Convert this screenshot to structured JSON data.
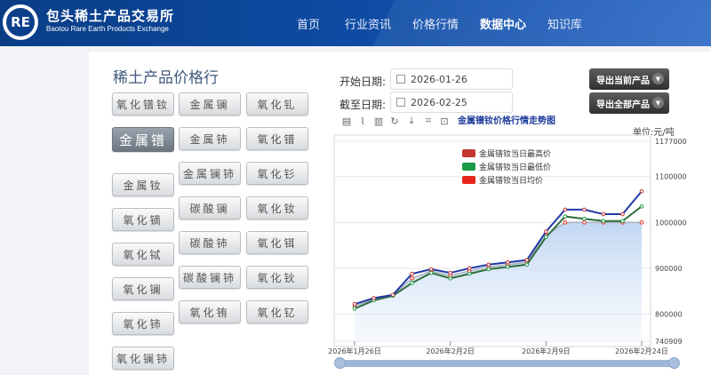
{
  "header": {
    "logo_mark": "RE",
    "logo_cn": "包头稀土产品交易所",
    "logo_en": "Baotou Rare Earth Products Exchange",
    "nav": [
      {
        "label": "首页",
        "active": false
      },
      {
        "label": "行业资讯",
        "active": false
      },
      {
        "label": "价格行情",
        "active": false
      },
      {
        "label": "数据中心",
        "active": true
      },
      {
        "label": "知识库",
        "active": false
      }
    ]
  },
  "page_title": "稀土产品价格行",
  "products": [
    {
      "label": "氧化镨钕",
      "active": false
    },
    {
      "label": "金属镧",
      "active": false
    },
    {
      "label": "氧化钆",
      "active": false
    },
    {
      "label": "金属镨",
      "active": true
    },
    {
      "label": "金属铈",
      "active": false
    },
    {
      "label": "氧化镨",
      "active": false
    },
    {
      "label": "金属镧铈",
      "active": false
    },
    {
      "label": "氧化钐",
      "active": false
    },
    {
      "label": "金属钕",
      "active": false
    },
    {
      "label": "碳酸镧",
      "active": false
    },
    {
      "label": "氧化钕",
      "active": false
    },
    {
      "label": "氧化镝",
      "active": false
    },
    {
      "label": "碳酸铈",
      "active": false
    },
    {
      "label": "氧化铒",
      "active": false
    },
    {
      "label": "氧化铽",
      "active": false
    },
    {
      "label": "碳酸镧铈",
      "active": false
    },
    {
      "label": "氧化钬",
      "active": false
    },
    {
      "label": "氧化镧",
      "active": false
    },
    {
      "label": "氧化铕",
      "active": false
    },
    {
      "label": "氧化钇",
      "active": false
    },
    {
      "label": "氧化铈",
      "active": false
    },
    {
      "label": "氧化镧铈",
      "active": false
    }
  ],
  "filters": {
    "start_label": "开始日期:",
    "start_value": "2026-01-26",
    "end_label": "截至日期:",
    "end_value": "2026-02-25"
  },
  "exports": {
    "current": "导出当前产品",
    "all": "导出全部产品",
    "chevron_icon": "chevron-down-icon"
  },
  "toolbar_icons": [
    "document-icon",
    "line-chart-icon",
    "bar-chart-icon",
    "refresh-icon",
    "download-icon",
    "crop-icon",
    "restore-icon"
  ],
  "chart_data": {
    "type": "line",
    "title": "金属镨钕价格行情走势图",
    "unit": "单位:元/吨",
    "x": [
      "2026-01-26",
      "2026-01-27",
      "2026-01-28",
      "2026-01-29",
      "2026-01-30",
      "2026-02-02",
      "2026-02-03",
      "2026-02-04",
      "2026-02-05",
      "2026-02-06",
      "2026-02-09",
      "2026-02-10",
      "2026-02-11",
      "2026-02-12",
      "2026-02-13",
      "2026-02-24"
    ],
    "x_tick_labels": [
      "2026年1月26日",
      "2026年2月2日",
      "2026年2月9日",
      "2026年2月24日"
    ],
    "x_tick_indices": [
      0,
      5,
      10,
      15
    ],
    "ylim": [
      740909,
      1177000
    ],
    "y_tick_labels": [
      "1177000",
      "1100000",
      "1000000",
      "900000",
      "800000",
      "740909"
    ],
    "y_tick_values": [
      1177000,
      1100000,
      1000000,
      900000,
      800000,
      740909
    ],
    "grid": true,
    "legend_position": "top",
    "series": [
      {
        "name": "金属镨钕当日最高价",
        "color": "#c23531",
        "line_color": "#2038a8",
        "values": [
          822000,
          835000,
          842000,
          888000,
          898000,
          890000,
          900000,
          908000,
          913000,
          918000,
          980000,
          1028000,
          1028000,
          1018000,
          1018000,
          1068000
        ]
      },
      {
        "name": "金属镨钕当日最低价",
        "color": "#1a9b48",
        "line_color": "#2e6e3c",
        "values": [
          812000,
          830000,
          840000,
          868000,
          890000,
          878000,
          888000,
          898000,
          903000,
          908000,
          968000,
          1013000,
          1008000,
          1003000,
          1003000,
          1035000
        ]
      },
      {
        "name": "金属镨钕当日均价",
        "color": "#e8251c",
        "line_color": "#aab4bf",
        "values": [
          818000,
          832000,
          841000,
          878000,
          894000,
          884000,
          894000,
          903000,
          908000,
          913000,
          972000,
          1000000,
          1000000,
          1000000,
          1000000,
          1000000
        ]
      }
    ]
  }
}
